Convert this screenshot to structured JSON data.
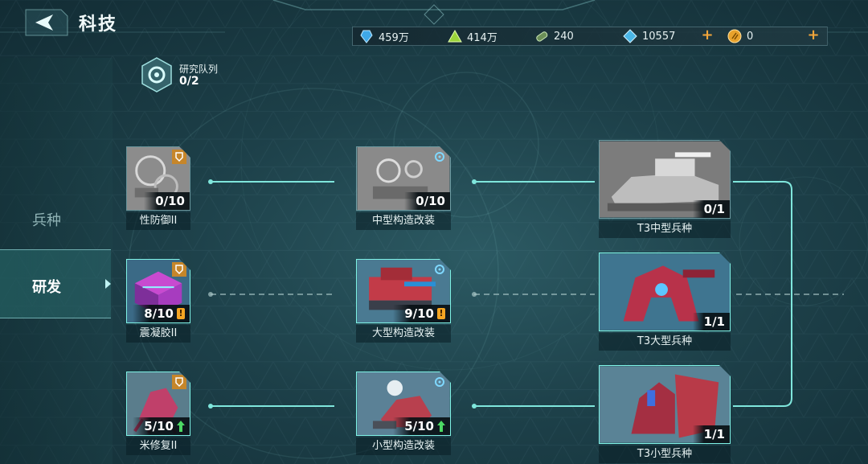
{
  "header": {
    "title": "科技"
  },
  "resources": [
    {
      "icon": "blue-crystal-icon",
      "value": "459万"
    },
    {
      "icon": "green-pyramid-icon",
      "value": "414万"
    },
    {
      "icon": "green-capsule-icon",
      "value": "240"
    },
    {
      "icon": "blue-diamond-icon",
      "value": "10557",
      "plus": "+"
    },
    {
      "icon": "gold-coin-icon",
      "value": "0",
      "plus": "+"
    }
  ],
  "queue": {
    "label": "研究队列",
    "value": "0/2"
  },
  "sidebar": {
    "tabs": [
      {
        "label": "兵种",
        "selected": false
      },
      {
        "label": "研发",
        "selected": true
      }
    ]
  },
  "tree": {
    "col1": [
      {
        "name": "性防御II",
        "progress": "0/10",
        "status": "none",
        "type": "shield-icon",
        "active": false
      },
      {
        "name": "震凝胶II",
        "progress": "8/10",
        "status": "!",
        "type": "shield-icon",
        "active": true
      },
      {
        "name": "米修复II",
        "progress": "5/10",
        "status": "up",
        "type": "shield-icon",
        "active": true
      }
    ],
    "col2": [
      {
        "name": "中型构造改装",
        "progress": "0/10",
        "status": "none",
        "type": "gear-icon",
        "active": false
      },
      {
        "name": "大型构造改装",
        "progress": "9/10",
        "status": "!",
        "type": "gear-icon",
        "active": true
      },
      {
        "name": "小型构造改装",
        "progress": "5/10",
        "status": "up",
        "type": "gear-icon",
        "active": true
      }
    ],
    "col3": [
      {
        "name": "T3中型兵种",
        "progress": "0/1",
        "tier": "T3",
        "active": false
      },
      {
        "name": "T3大型兵种",
        "progress": "1/1",
        "tier": "T3",
        "active": true
      },
      {
        "name": "T3小型兵种",
        "progress": "1/1",
        "tier": "T3",
        "active": true
      }
    ]
  },
  "colors": {
    "accent": "#7ff2e6",
    "warning": "#f5a623",
    "upgrade": "#4cd964",
    "plus": "#f3a63a"
  }
}
